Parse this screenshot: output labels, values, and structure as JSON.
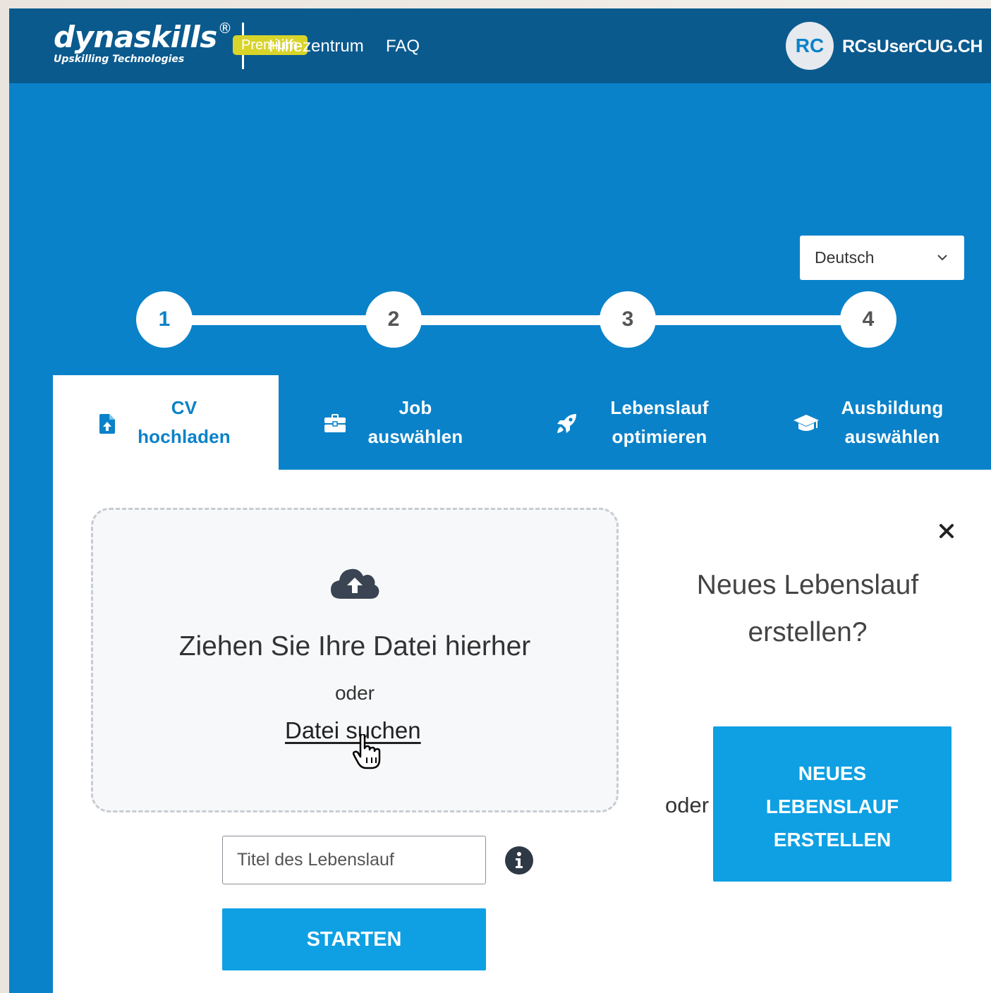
{
  "header": {
    "logo_name": "dynaskills",
    "logo_registered": "®",
    "logo_tagline": "Upskilling Technologies",
    "premium_badge": "Premium",
    "help_link": "Hilfezentrum",
    "faq_link": "FAQ",
    "avatar_initials": "RC",
    "username": "RCsUserCUG.CH"
  },
  "language": {
    "selected": "Deutsch"
  },
  "stepper": {
    "steps": [
      "1",
      "2",
      "3",
      "4"
    ],
    "current": 1
  },
  "tabs": [
    {
      "line1": "CV",
      "line2": "hochladen",
      "icon": "file-upload-icon",
      "active": true
    },
    {
      "line1": "Job",
      "line2": "auswählen",
      "icon": "briefcase-icon",
      "active": false
    },
    {
      "line1": "Lebenslauf",
      "line2": "optimieren",
      "icon": "rocket-icon",
      "active": false
    },
    {
      "line1": "Ausbildung",
      "line2": "auswählen",
      "icon": "graduation-cap-icon",
      "active": false
    }
  ],
  "upload": {
    "drop_title": "Ziehen Sie Ihre Datei hierher",
    "or_text": "oder",
    "browse_link": "Datei suchen",
    "title_placeholder": "Titel des Lebenslauf",
    "start_button": "STARTEN"
  },
  "new_cv": {
    "question_line1": "Neues Lebenslauf",
    "question_line2": "erstellen?",
    "or_text": "oder",
    "button_line1": "NEUES",
    "button_line2": "LEBENSLAUF",
    "button_line3": "ERSTELLEN"
  },
  "colors": {
    "header_bg": "#0a5a8e",
    "primary_blue": "#0a82c9",
    "button_blue": "#0ea0e3",
    "premium_yellow": "#d8d42a"
  }
}
